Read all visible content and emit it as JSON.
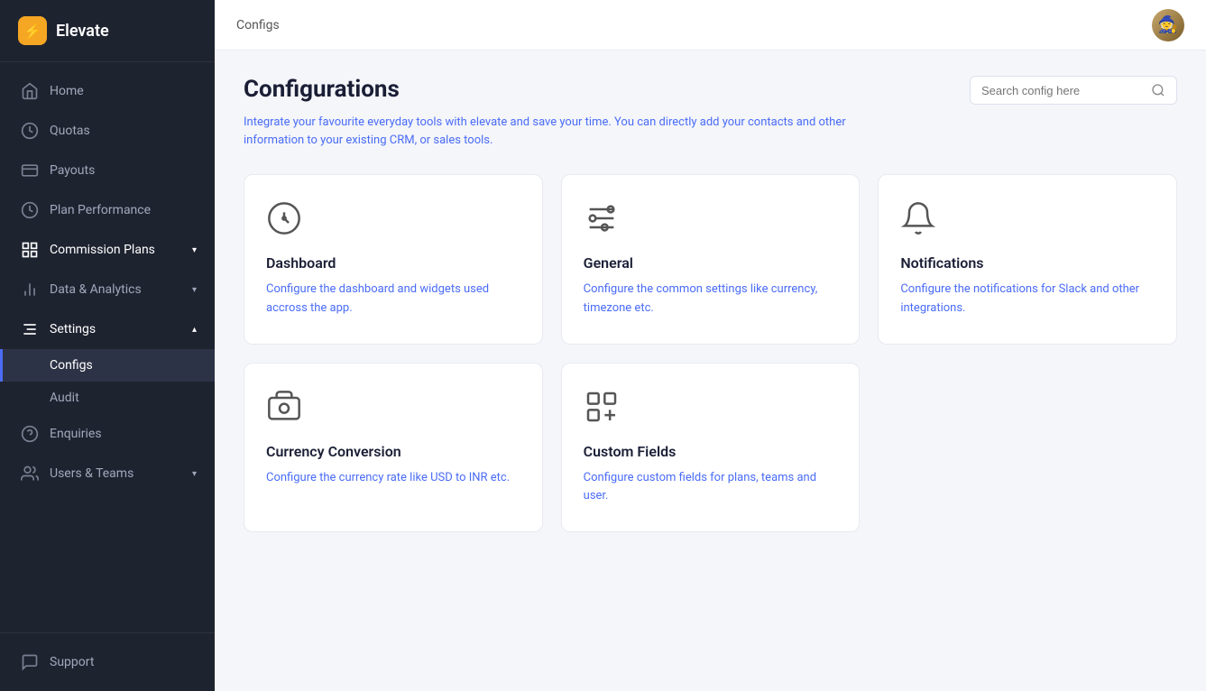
{
  "app": {
    "name": "Elevate",
    "logo_icon": "⚡"
  },
  "sidebar": {
    "nav_items": [
      {
        "id": "home",
        "label": "Home",
        "icon": "home"
      },
      {
        "id": "quotas",
        "label": "Quotas",
        "icon": "quotas"
      },
      {
        "id": "payouts",
        "label": "Payouts",
        "icon": "payouts"
      },
      {
        "id": "plan-performance",
        "label": "Plan Performance",
        "icon": "plan-performance"
      },
      {
        "id": "commission-plans",
        "label": "Commission Plans",
        "icon": "commission-plans",
        "expandable": true
      },
      {
        "id": "data-analytics",
        "label": "Data & Analytics",
        "icon": "data-analytics",
        "expandable": true
      },
      {
        "id": "settings",
        "label": "Settings",
        "icon": "settings",
        "expandable": true,
        "expanded": true
      }
    ],
    "settings_sub": [
      {
        "id": "configs",
        "label": "Configs",
        "active": true
      },
      {
        "id": "audit",
        "label": "Audit",
        "active": false
      }
    ],
    "footer_items": [
      {
        "id": "enquiries",
        "label": "Enquiries",
        "icon": "enquiries"
      },
      {
        "id": "users-teams",
        "label": "Users & Teams",
        "icon": "users-teams",
        "expandable": true
      },
      {
        "id": "support",
        "label": "Support",
        "icon": "support"
      }
    ]
  },
  "topbar": {
    "breadcrumb": "Configs",
    "search_placeholder": "Search config here"
  },
  "page": {
    "title": "Configurations",
    "subtitle": "Integrate your favourite everyday tools with elevate and save your time. You can directly add your contacts and other information to your existing CRM, or sales tools."
  },
  "cards": [
    {
      "id": "dashboard",
      "title": "Dashboard",
      "description": "Configure the dashboard and widgets used accross the app.",
      "icon": "dashboard"
    },
    {
      "id": "general",
      "title": "General",
      "description": "Configure the common settings like currency, timezone etc.",
      "icon": "general"
    },
    {
      "id": "notifications",
      "title": "Notifications",
      "description": "Configure the notifications for Slack and other integrations.",
      "icon": "notifications"
    },
    {
      "id": "currency-conversion",
      "title": "Currency Conversion",
      "description": "Configure the currency rate like USD to INR etc.",
      "icon": "currency"
    },
    {
      "id": "custom-fields",
      "title": "Custom Fields",
      "description": "Configure custom fields for plans, teams and user.",
      "icon": "custom-fields"
    }
  ]
}
